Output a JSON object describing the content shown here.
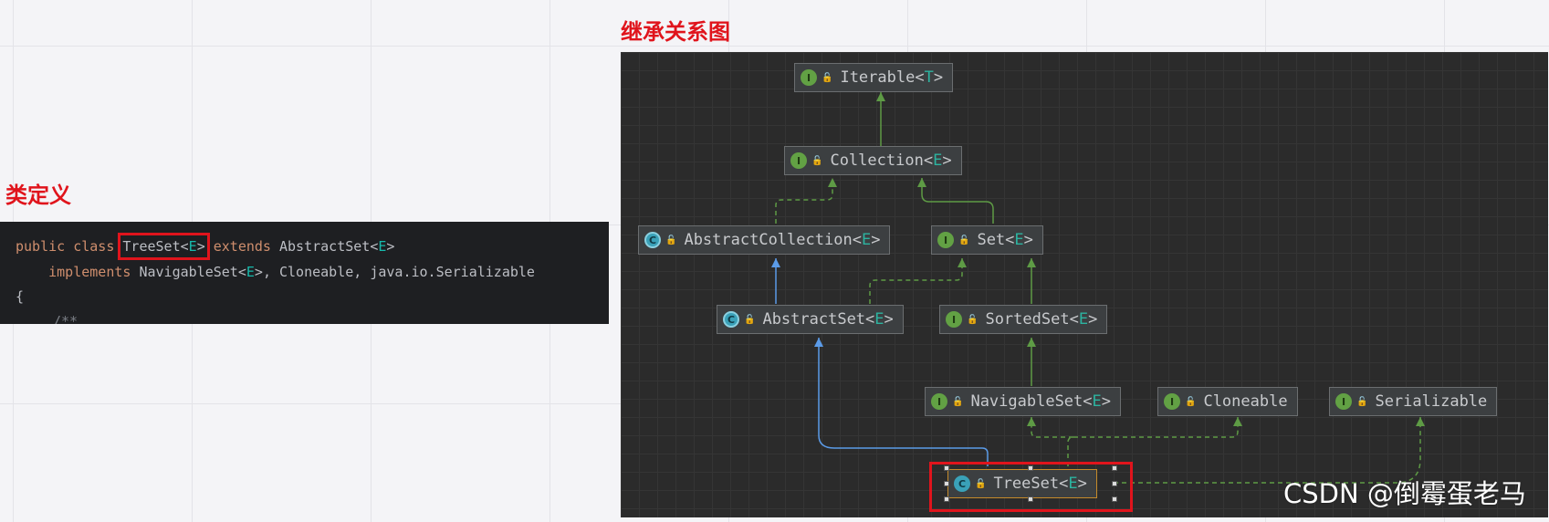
{
  "headings": {
    "class_def": "类定义",
    "hierarchy": "继承关系图"
  },
  "code": {
    "l1_kw1": "public",
    "l1_kw2": "class",
    "l1_class": "TreeSet",
    "l1_lt": "<",
    "l1_E": "E",
    "l1_gt": ">",
    "l1_kw3": "extends",
    "l1_super": "AbstractSet",
    "l1_super_E": "E",
    "l2_kw": "implements",
    "l2_iface1": "NavigableSet",
    "l2_iface1_E": "E",
    "l2_rest": ", Cloneable, java.io.Serializable",
    "l3": "{",
    "l4": "/**"
  },
  "nodes": {
    "iterable": {
      "badge": "I",
      "name": "Iterable",
      "param": "T"
    },
    "collection": {
      "badge": "I",
      "name": "Collection",
      "param": "E"
    },
    "abstract_collection": {
      "badge": "C",
      "name": "AbstractCollection",
      "param": "E"
    },
    "set": {
      "badge": "I",
      "name": "Set",
      "param": "E"
    },
    "abstract_set": {
      "badge": "C",
      "name": "AbstractSet",
      "param": "E"
    },
    "sorted_set": {
      "badge": "I",
      "name": "SortedSet",
      "param": "E"
    },
    "navigable_set": {
      "badge": "I",
      "name": "NavigableSet",
      "param": "E"
    },
    "cloneable": {
      "badge": "I",
      "name": "Cloneable"
    },
    "serializable": {
      "badge": "I",
      "name": "Serializable"
    },
    "tree_set": {
      "badge": "C",
      "name": "TreeSet",
      "param": "E"
    }
  },
  "colors": {
    "highlight": "#e0141c",
    "interface_badge": "#62a144",
    "class_badge": "#3aa1b8",
    "extends_edge": "#5b9be8",
    "implements_edge": "#5e9b45"
  },
  "watermark": "CSDN @倒霉蛋老马"
}
